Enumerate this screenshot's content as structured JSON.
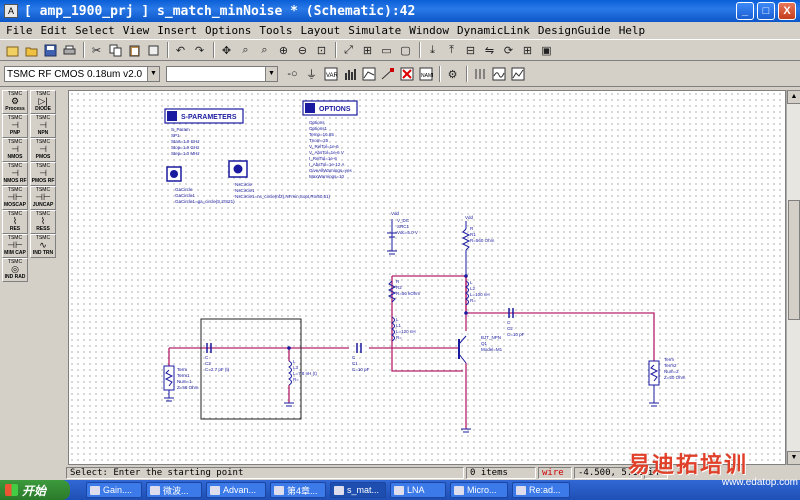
{
  "window": {
    "title": "[ amp_1900_prj ] s_match_minNoise * (Schematic):42",
    "minimize": "_",
    "maximize": "□",
    "close": "X"
  },
  "menu": [
    "File",
    "Edit",
    "Select",
    "View",
    "Insert",
    "Options",
    "Tools",
    "Layout",
    "Simulate",
    "Window",
    "DynamicLink",
    "DesignGuide",
    "Help"
  ],
  "toolbar2": {
    "library": "TSMC RF CMOS 0.18um v2.0",
    "component": ""
  },
  "palette": [
    {
      "tag": "TSMC",
      "label": "Process",
      "glyph": "⚙"
    },
    {
      "tag": "TSMC",
      "label": "DIODE",
      "glyph": "▷|"
    },
    {
      "tag": "TSMC",
      "label": "PNP",
      "glyph": "⊣"
    },
    {
      "tag": "TSMC",
      "label": "NPN",
      "glyph": "⊣"
    },
    {
      "tag": "TSMC",
      "label": "NMOS",
      "glyph": "⊣"
    },
    {
      "tag": "TSMC",
      "label": "PMOS",
      "glyph": "⊣"
    },
    {
      "tag": "TSMC",
      "label": "NMOS RF",
      "glyph": "⊣"
    },
    {
      "tag": "TSMC",
      "label": "PMOS RF",
      "glyph": "⊣"
    },
    {
      "tag": "TSMC",
      "label": "MOSCAP",
      "glyph": "⊣⊢"
    },
    {
      "tag": "TSMC",
      "label": "JUNCAP",
      "glyph": "⊣⊢"
    },
    {
      "tag": "TSMC",
      "label": "RES",
      "glyph": "⌇"
    },
    {
      "tag": "TSMC",
      "label": "RESS",
      "glyph": "⌇"
    },
    {
      "tag": "TSMC",
      "label": "MIM CAP",
      "glyph": "⊣⊢"
    },
    {
      "tag": "TSMC",
      "label": "IND TRN",
      "glyph": "∿"
    },
    {
      "tag": "TSMC",
      "label": "IND RAD",
      "glyph": "◎"
    }
  ],
  "schematic": {
    "sparams": {
      "title": "S-PARAMETERS",
      "lines": [
        "S_Param",
        "SP1",
        "Start=1.9 GHz",
        "Stop=1.9 GHz",
        "Step=1.0 MHz"
      ]
    },
    "options": {
      "title": "OPTIONS",
      "lines": [
        "Options",
        "Options1",
        "Temp=16.85",
        "Tnom=25",
        "V_RelTol=1e-6",
        "V_AbsTol=1e-6 V",
        "I_RelTol=1e-6",
        "I_AbsTol=1e-12 A",
        "GiveAllWarnings=yes",
        "MaxWarnings=10"
      ]
    },
    "gacircle": {
      "lines": [
        "GaCircle",
        "GaCircle1",
        "GaCircle1=ga_circle(S,2!S21)"
      ]
    },
    "nscircle": {
      "lines": [
        "NsCircle",
        "NsCircle1",
        "NsCircle1=ns_circle(nf2),NFmin,Sopt,Rn/50,51)"
      ]
    },
    "vdc": {
      "lines": [
        "Vdd",
        "V_DC",
        "SRC1",
        "Vdc=5.0 V"
      ]
    },
    "r1": {
      "lines": [
        "Vdd",
        "R",
        "R1",
        "R=560 Ohm"
      ]
    },
    "r2": {
      "lines": [
        "R",
        "R2",
        "R=56 kOhm"
      ]
    },
    "l2": {
      "lines": [
        "L",
        "L2",
        "L=100 nH",
        "R="
      ]
    },
    "l1": {
      "lines": [
        "L",
        "L1",
        "L=120 nH",
        "R="
      ]
    },
    "c2": {
      "lines": [
        "C",
        "C2",
        "C=10 pF"
      ]
    },
    "c3": {
      "lines": [
        "C",
        "C3",
        "C=2.7 pF (t)"
      ]
    },
    "l3": {
      "lines": [
        "L",
        "L3",
        "L=7.8 nH (t)",
        "R="
      ]
    },
    "c1": {
      "lines": [
        "C",
        "C1",
        "C=10 pF"
      ]
    },
    "bjt": {
      "lines": [
        "BJT_NPN",
        "Q1",
        "Model=M1"
      ]
    },
    "term1": {
      "lines": [
        "Term",
        "Term1",
        "Num=1",
        "Z=50 Ohm"
      ]
    },
    "term2": {
      "lines": [
        "Term",
        "Term2",
        "Num=2",
        "Z=50 Ohm"
      ]
    }
  },
  "status": {
    "message": "Select: Enter the starting point",
    "items": "0 items",
    "mode": "wire",
    "coords": "-4.500, 5.125",
    "unit": "in"
  },
  "taskbar": {
    "start": "开始",
    "tasks": [
      "Gain....",
      "微波...",
      "Advan...",
      "第4章...",
      "s_mat...",
      "LNA",
      "Micro...",
      "Re:ad..."
    ]
  },
  "watermark": {
    "brand": "易迪拓培训",
    "url": "www.edatop.com"
  },
  "colors": {
    "wire": "#b5206a",
    "component": "#1a1aa0",
    "canvas": "#ffffff",
    "titlebar": "#0a5fd6"
  }
}
